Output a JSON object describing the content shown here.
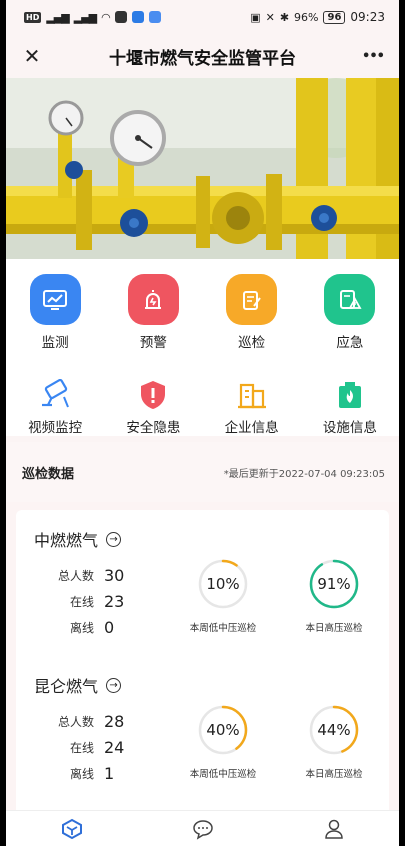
{
  "statusbar": {
    "left_chips": [
      "HD",
      "B"
    ],
    "signal": "4G",
    "battery": "96%",
    "time": "09:23"
  },
  "titlebar": {
    "title": "十堰市燃气安全监管平台",
    "close_glyph": "✕",
    "more_glyph": "•••"
  },
  "menu": {
    "row1": [
      {
        "label": "监测",
        "color": "#3a86f2",
        "icon": "monitor-chart-icon"
      },
      {
        "label": "预警",
        "color": "#ef5560",
        "icon": "alarm-siren-icon"
      },
      {
        "label": "巡检",
        "color": "#f7a928",
        "icon": "clipboard-pen-icon"
      },
      {
        "label": "应急",
        "color": "#20c48d",
        "icon": "warning-doc-icon"
      }
    ],
    "row2": [
      {
        "label": "视频监控",
        "icon": "camera-icon"
      },
      {
        "label": "安全隐患",
        "icon": "shield-alert-icon"
      },
      {
        "label": "企业信息",
        "icon": "building-icon"
      },
      {
        "label": "设施信息",
        "icon": "fire-facility-icon"
      }
    ]
  },
  "inspection": {
    "section_title": "巡检数据",
    "updated": "*最后更新于2022-07-04 09:23:05",
    "companies": [
      {
        "name": "中燃燃气",
        "stats": [
          {
            "label": "总人数",
            "value": "30"
          },
          {
            "label": "在线",
            "value": "23"
          },
          {
            "label": "离线",
            "value": "0"
          }
        ],
        "rings": [
          {
            "pct_text": "10%",
            "fraction": 0.1,
            "label": "本周低中压巡检",
            "color": "#f2a81b"
          },
          {
            "pct_text": "91%",
            "fraction": 0.91,
            "label": "本日高压巡检",
            "color": "#20b889"
          }
        ]
      },
      {
        "name": "昆仑燃气",
        "stats": [
          {
            "label": "总人数",
            "value": "28"
          },
          {
            "label": "在线",
            "value": "24"
          },
          {
            "label": "离线",
            "value": "1"
          }
        ],
        "rings": [
          {
            "pct_text": "40%",
            "fraction": 0.4,
            "label": "本周低中压巡检",
            "color": "#f2a81b"
          },
          {
            "pct_text": "44%",
            "fraction": 0.44,
            "label": "本日高压巡检",
            "color": "#f2a81b"
          }
        ]
      }
    ]
  },
  "tabbar": {
    "tabs": [
      {
        "icon": "home-cube-icon",
        "active_color": "#2f6fd8"
      },
      {
        "icon": "message-icon"
      },
      {
        "icon": "user-icon"
      }
    ]
  }
}
